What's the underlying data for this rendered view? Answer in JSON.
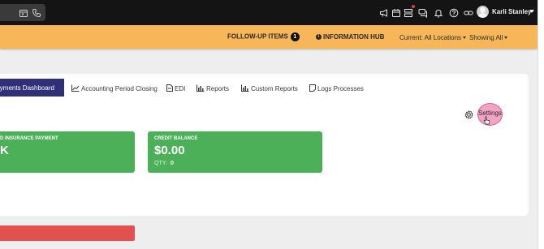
{
  "topbar": {
    "user_name": "Karli Stanley"
  },
  "followup": {
    "label": "FOLLOW-UP ITEMS",
    "count": "1"
  },
  "info_hub": {
    "label": "INFORMATION HUB"
  },
  "filters": {
    "location": "Current: All Locations",
    "showing": "Showing All"
  },
  "tabs": [
    {
      "label": "Payments Dashboard",
      "active": true
    },
    {
      "label": "Accounting Period Closing"
    },
    {
      "label": "EDI"
    },
    {
      "label": "Reports"
    },
    {
      "label": "Custom Reports"
    },
    {
      "label": "Logs Processes"
    }
  ],
  "settings": {
    "label": "Settings"
  },
  "cards": [
    {
      "title": "D INSURANCE PAYMENT",
      "value": "K"
    },
    {
      "title": "CREDIT BALANCE",
      "value": "$0.00",
      "qty_label": "QTY:",
      "qty_value": "0"
    }
  ],
  "colors": {
    "topbar": "#141414",
    "orange_bar": "#f7b657",
    "active_tab": "#2f2f7a",
    "green_card": "#4cb058",
    "red_bar": "#e25050",
    "settings_highlight": "#e85a96"
  },
  "icons": {
    "search": [
      "calendar-icon",
      "phone-icon"
    ],
    "toolbar": [
      "megaphone-icon",
      "calendar-icon",
      "server-icon",
      "chat-icon",
      "bell-icon",
      "help-icon",
      "link-icon"
    ]
  }
}
